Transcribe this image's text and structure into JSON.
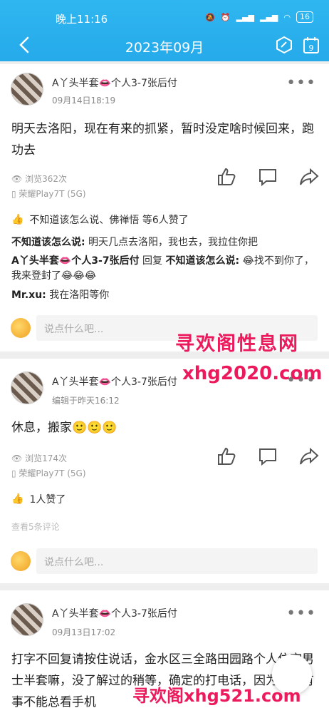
{
  "status": {
    "time": "晚上11:16",
    "battery": "16"
  },
  "nav": {
    "title": "2023年09月"
  },
  "posts": [
    {
      "username": "A丫头半套👄个人3-7张后付",
      "time": "09月14日18:19",
      "content": "明天去洛阳，现在有来的抓紧，暂时没定啥时候回来，跑功去",
      "views": "浏览362次",
      "device": "荣耀Play7T (5G)",
      "likes": "不知道该怎么说、佛禅悟 等6人赞了",
      "comments": [
        {
          "name": "不知道该怎么说:",
          "text": " 明天几点去洛阳，我也去，我拉住你把"
        },
        {
          "name": "A丫头半套👄个人3-7张后付",
          "reply": " 回复 ",
          "target": "不知道该怎么说:",
          "text": " 😂找不到你了，我来登封了😂😂😂"
        },
        {
          "name": "Mr.xu:",
          "text": " 我在洛阳等你"
        }
      ],
      "comment_placeholder": "说点什么吧..."
    },
    {
      "username": "A丫头半套👄个人3-7张后付",
      "time": "编辑于昨天16:12",
      "content": "休息，搬家🙂🙂🙂",
      "views": "浏览174次",
      "device": "荣耀Play7T (5G)",
      "likes": "1人赞了",
      "see_more": "查看5条评论",
      "comment_placeholder": "说点什么吧..."
    },
    {
      "username": "A丫头半套👄个人3-7张后付",
      "time": "09月13日17:02",
      "content": "打字不回复请按住说话，金水区三全路田园路个人住宅男士半套嘛，没了解过的稍等，确定的打电话，因为手里有事不能总看手机"
    }
  ],
  "watermarks": {
    "top": "寻欢阁性息网",
    "mid": "xhg2020.com",
    "bottom": "寻欢阁xhg521.com"
  },
  "colors": {
    "header": "#2fb6f0",
    "watermark": "#ec1a5c"
  }
}
